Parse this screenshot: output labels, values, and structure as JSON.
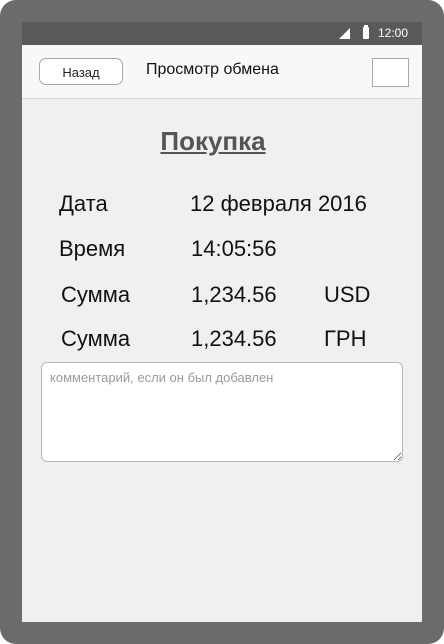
{
  "status_bar": {
    "time": "12:00",
    "icons": [
      "signal-icon",
      "battery-icon"
    ]
  },
  "header": {
    "back_label": "Назад",
    "title": "Просмотр обмена"
  },
  "main": {
    "title": "Покупка",
    "rows": [
      {
        "label": "Дата",
        "value": "12 февраля 2016",
        "currency": ""
      },
      {
        "label": "Время",
        "value": "14:05:56",
        "currency": ""
      },
      {
        "label": "Сумма",
        "value": "1,234.56",
        "currency": "USD"
      },
      {
        "label": "Сумма",
        "value": "1,234.56",
        "currency": "ГРН"
      }
    ],
    "comment_placeholder": "комментарий, если он был добавлен",
    "comment_value": ""
  },
  "colors": {
    "frame": "#6b6b6b",
    "status_bar": "#5a5a5a",
    "screen": "#f0f0f2",
    "title": "#555555"
  }
}
